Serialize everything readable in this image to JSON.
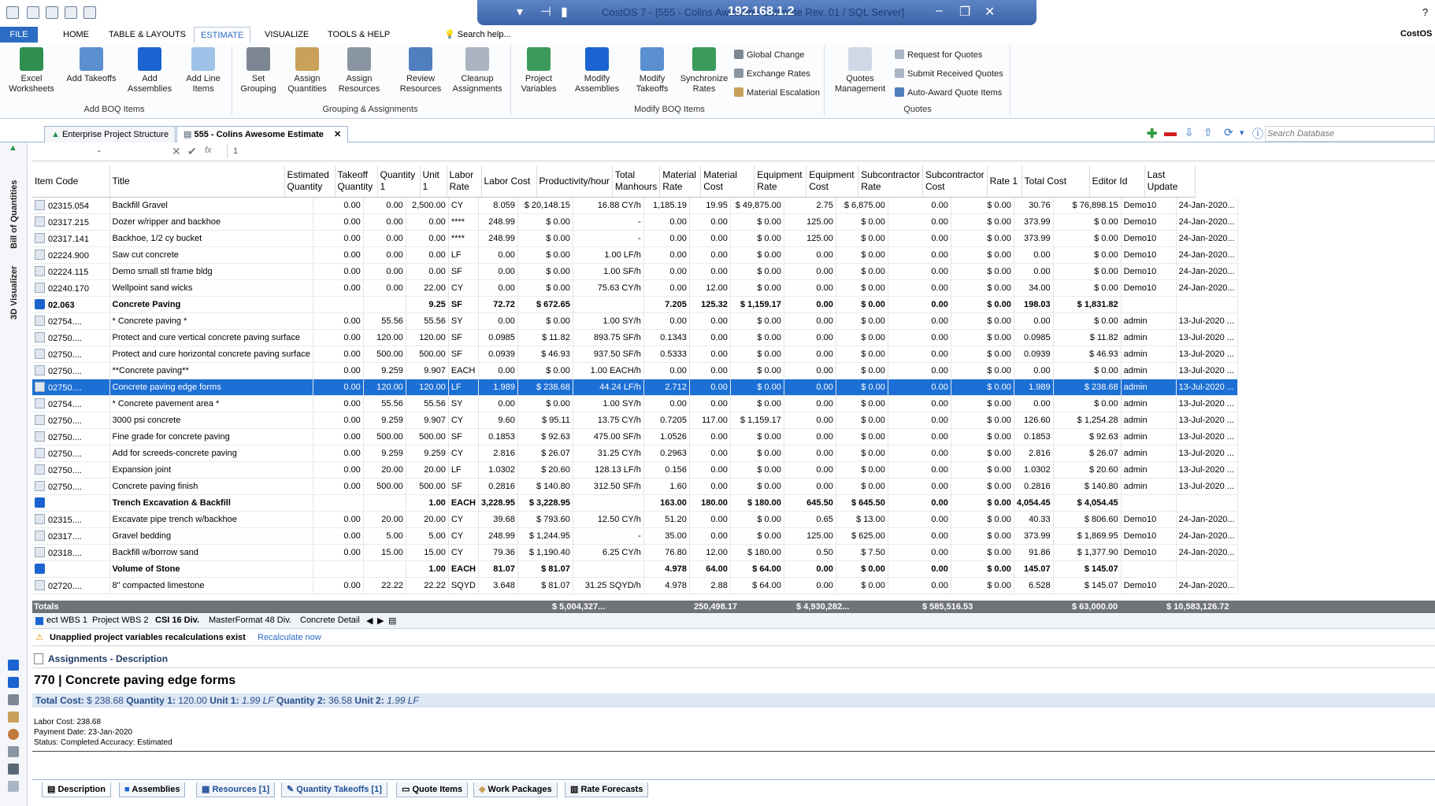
{
  "window": {
    "ip": "192.168.1.2",
    "title": "CostOS 7 - [555 - Colins Awesome Estimate  Rev. 01 / SQL Server]",
    "app_label": "CostOS",
    "help_char": "?"
  },
  "ribbon": {
    "tabs": [
      "FILE",
      "HOME",
      "TABLE & LAYOUTS",
      "ESTIMATE",
      "VISUALIZE",
      "TOOLS & HELP"
    ],
    "active_tab": "ESTIMATE",
    "search_help": "Search help...",
    "buttons": {
      "excel": "Excel Worksheets",
      "add_takeoffs": "Add Takeoffs",
      "add_assemblies": "Add Assemblies",
      "add_line_items": "Add Line Items",
      "set_grouping": "Set Grouping",
      "assign_quantities": "Assign Quantities",
      "assign_resources": "Assign Resources",
      "review_resources": "Review Resources",
      "cleanup_assignments": "Cleanup Assignments",
      "project_variables": "Project Variables",
      "modify_assemblies": "Modify Assemblies",
      "modify_takeoffs": "Modify Takeoffs",
      "synchronize_rates": "Synchronize Rates",
      "global_change": "Global Change",
      "exchange_rates": "Exchange Rates",
      "material_escalation": "Material Escalation",
      "quotes_management": "Quotes Management",
      "request_for_quotes": "Request for Quotes",
      "submit_received_quotes": "Submit Received Quotes",
      "auto_award": "Auto-Award Quote Items"
    },
    "groups": [
      "Add BOQ Items",
      "Grouping & Assignments",
      "Modify BOQ Items",
      "Quotes"
    ]
  },
  "doc_tabs": [
    "Enterprise Project Structure",
    "555 - Colins Awesome Estimate"
  ],
  "search_database_placeholder": "Search Database",
  "formula_bar": {
    "cell_ref": "-",
    "value": "1"
  },
  "left_strip": {
    "bill_of_quantities": "Bill of Quantities",
    "visualizer": "3D Visualizer"
  },
  "columns": [
    "Item Code",
    "Title",
    "Estimated Quantity",
    "Takeoff Quantity",
    "Quantity 1",
    "Unit 1",
    "Labor Rate",
    "Labor Cost",
    "Productivity/hour",
    "Total Manhours",
    "Material Rate",
    "Material Cost",
    "Equipment Rate",
    "Equipment Cost",
    "Subcontractor Rate",
    "Subcontractor Cost",
    "Rate 1",
    "Total Cost",
    "Editor Id",
    "Last Update"
  ],
  "rows": [
    {
      "lvl": 2,
      "code": "02315.054",
      "title": "Backfill Gravel",
      "eq": "0.00",
      "tq": "0.00",
      "q1": "2,500.00",
      "u": "CY",
      "lr": "8.059",
      "lc": "$ 20,148.15",
      "prod": "16.88 CY/h",
      "mh": "1,185.19",
      "mr": "19.95",
      "mc": "$ 49,875.00",
      "er": "2.75",
      "ec": "$ 6,875.00",
      "sr": "0.00",
      "sc": "$ 0.00",
      "r1": "30.76",
      "tc": "$ 76,898.15",
      "ed": "Demo10",
      "lu": "24-Jan-2020..."
    },
    {
      "lvl": 2,
      "code": "02317.215",
      "title": "Dozer w/ripper and backhoe",
      "eq": "0.00",
      "tq": "0.00",
      "q1": "0.00",
      "u": "****",
      "lr": "248.99",
      "lc": "$ 0.00",
      "prod": "-",
      "mh": "0.00",
      "mr": "0.00",
      "mc": "$ 0.00",
      "er": "125.00",
      "ec": "$ 0.00",
      "sr": "0.00",
      "sc": "$ 0.00",
      "r1": "373.99",
      "tc": "$ 0.00",
      "ed": "Demo10",
      "lu": "24-Jan-2020..."
    },
    {
      "lvl": 2,
      "code": "02317.141",
      "title": "Backhoe, 1/2 cy bucket",
      "eq": "0.00",
      "tq": "0.00",
      "q1": "0.00",
      "u": "****",
      "lr": "248.99",
      "lc": "$ 0.00",
      "prod": "-",
      "mh": "0.00",
      "mr": "0.00",
      "mc": "$ 0.00",
      "er": "125.00",
      "ec": "$ 0.00",
      "sr": "0.00",
      "sc": "$ 0.00",
      "r1": "373.99",
      "tc": "$ 0.00",
      "ed": "Demo10",
      "lu": "24-Jan-2020..."
    },
    {
      "lvl": 2,
      "code": "02224.900",
      "title": "Saw cut concrete",
      "eq": "0.00",
      "tq": "0.00",
      "q1": "0.00",
      "u": "LF",
      "lr": "0.00",
      "lc": "$ 0.00",
      "prod": "1.00 LF/h",
      "mh": "0.00",
      "mr": "0.00",
      "mc": "$ 0.00",
      "er": "0.00",
      "ec": "$ 0.00",
      "sr": "0.00",
      "sc": "$ 0.00",
      "r1": "0.00",
      "tc": "$ 0.00",
      "ed": "Demo10",
      "lu": "24-Jan-2020..."
    },
    {
      "lvl": 2,
      "code": "02224.115",
      "title": "Demo small stl frame bldg",
      "eq": "0.00",
      "tq": "0.00",
      "q1": "0.00",
      "u": "SF",
      "lr": "0.00",
      "lc": "$ 0.00",
      "prod": "1.00 SF/h",
      "mh": "0.00",
      "mr": "0.00",
      "mc": "$ 0.00",
      "er": "0.00",
      "ec": "$ 0.00",
      "sr": "0.00",
      "sc": "$ 0.00",
      "r1": "0.00",
      "tc": "$ 0.00",
      "ed": "Demo10",
      "lu": "24-Jan-2020..."
    },
    {
      "lvl": 2,
      "code": "02240.170",
      "title": "Wellpoint sand wicks",
      "eq": "0.00",
      "tq": "0.00",
      "q1": "22.00",
      "u": "CY",
      "lr": "0.00",
      "lc": "$ 0.00",
      "prod": "75.63 CY/h",
      "mh": "0.00",
      "mr": "12.00",
      "mc": "$ 0.00",
      "er": "0.00",
      "ec": "$ 0.00",
      "sr": "0.00",
      "sc": "$ 0.00",
      "r1": "34.00",
      "tc": "$ 0.00",
      "ed": "Demo10",
      "lu": "24-Jan-2020..."
    },
    {
      "lvl": 1,
      "bold": true,
      "code": "02.063",
      "title": "Concrete Paving",
      "eq": "",
      "tq": "",
      "q1": "9.25",
      "u": "SF",
      "lr": "72.72",
      "lc": "$ 672.65",
      "prod": "",
      "mh": "7.205",
      "mr": "125.32",
      "mc": "$ 1,159.17",
      "er": "0.00",
      "ec": "$ 0.00",
      "sr": "0.00",
      "sc": "$ 0.00",
      "r1": "198.03",
      "tc": "$ 1,831.82",
      "ed": "",
      "lu": ""
    },
    {
      "lvl": 3,
      "code": "02754....",
      "title": "* Concrete paving *",
      "eq": "0.00",
      "tq": "55.56",
      "q1": "55.56",
      "u": "SY",
      "lr": "0.00",
      "lc": "$ 0.00",
      "prod": "1.00 SY/h",
      "mh": "0.00",
      "mr": "0.00",
      "mc": "$ 0.00",
      "er": "0.00",
      "ec": "$ 0.00",
      "sr": "0.00",
      "sc": "$ 0.00",
      "r1": "0.00",
      "tc": "$ 0.00",
      "ed": "admin",
      "lu": "13-Jul-2020 ..."
    },
    {
      "lvl": 3,
      "code": "02750....",
      "title": "Protect and cure vertical concrete paving surface",
      "eq": "0.00",
      "tq": "120.00",
      "q1": "120.00",
      "u": "SF",
      "lr": "0.0985",
      "lc": "$ 11.82",
      "prod": "893.75 SF/h",
      "mh": "0.1343",
      "mr": "0.00",
      "mc": "$ 0.00",
      "er": "0.00",
      "ec": "$ 0.00",
      "sr": "0.00",
      "sc": "$ 0.00",
      "r1": "0.0985",
      "tc": "$ 11.82",
      "ed": "admin",
      "lu": "13-Jul-2020 ..."
    },
    {
      "lvl": 3,
      "code": "02750....",
      "title": "Protect and cure horizontal concrete paving surface",
      "eq": "0.00",
      "tq": "500.00",
      "q1": "500.00",
      "u": "SF",
      "lr": "0.0939",
      "lc": "$ 46.93",
      "prod": "937.50 SF/h",
      "mh": "0.5333",
      "mr": "0.00",
      "mc": "$ 0.00",
      "er": "0.00",
      "ec": "$ 0.00",
      "sr": "0.00",
      "sc": "$ 0.00",
      "r1": "0.0939",
      "tc": "$ 46.93",
      "ed": "admin",
      "lu": "13-Jul-2020 ..."
    },
    {
      "lvl": 3,
      "code": "02750....",
      "title": "**Concrete paving**",
      "eq": "0.00",
      "tq": "9.259",
      "q1": "9.907",
      "u": "EACH",
      "lr": "0.00",
      "lc": "$ 0.00",
      "prod": "1.00 EACH/h",
      "mh": "0.00",
      "mr": "0.00",
      "mc": "$ 0.00",
      "er": "0.00",
      "ec": "$ 0.00",
      "sr": "0.00",
      "sc": "$ 0.00",
      "r1": "0.00",
      "tc": "$ 0.00",
      "ed": "admin",
      "lu": "13-Jul-2020 ..."
    },
    {
      "lvl": 3,
      "sel": true,
      "code": "02750....",
      "title": "Concrete paving edge forms",
      "eq": "0.00",
      "tq": "120.00",
      "q1": "120.00",
      "u": "LF",
      "lr": "1.989",
      "lc": "$ 238.68",
      "prod": "44.24 LF/h",
      "mh": "2.712",
      "mr": "0.00",
      "mc": "$ 0.00",
      "er": "0.00",
      "ec": "$ 0.00",
      "sr": "0.00",
      "sc": "$ 0.00",
      "r1": "1.989",
      "tc": "$ 238.68",
      "ed": "admin",
      "lu": "13-Jul-2020 ..."
    },
    {
      "lvl": 3,
      "code": "02754....",
      "title": "* Concrete pavement area *",
      "eq": "0.00",
      "tq": "55.56",
      "q1": "55.56",
      "u": "SY",
      "lr": "0.00",
      "lc": "$ 0.00",
      "prod": "1.00 SY/h",
      "mh": "0.00",
      "mr": "0.00",
      "mc": "$ 0.00",
      "er": "0.00",
      "ec": "$ 0.00",
      "sr": "0.00",
      "sc": "$ 0.00",
      "r1": "0.00",
      "tc": "$ 0.00",
      "ed": "admin",
      "lu": "13-Jul-2020 ..."
    },
    {
      "lvl": 3,
      "code": "02750....",
      "title": "3000 psi concrete",
      "eq": "0.00",
      "tq": "9.259",
      "q1": "9.907",
      "u": "CY",
      "lr": "9.60",
      "lc": "$ 95.11",
      "prod": "13.75 CY/h",
      "mh": "0.7205",
      "mr": "117.00",
      "mc": "$ 1,159.17",
      "er": "0.00",
      "ec": "$ 0.00",
      "sr": "0.00",
      "sc": "$ 0.00",
      "r1": "126.60",
      "tc": "$ 1,254.28",
      "ed": "admin",
      "lu": "13-Jul-2020 ..."
    },
    {
      "lvl": 3,
      "code": "02750....",
      "title": "Fine grade for concrete paving",
      "eq": "0.00",
      "tq": "500.00",
      "q1": "500.00",
      "u": "SF",
      "lr": "0.1853",
      "lc": "$ 92.63",
      "prod": "475.00 SF/h",
      "mh": "1.0526",
      "mr": "0.00",
      "mc": "$ 0.00",
      "er": "0.00",
      "ec": "$ 0.00",
      "sr": "0.00",
      "sc": "$ 0.00",
      "r1": "0.1853",
      "tc": "$ 92.63",
      "ed": "admin",
      "lu": "13-Jul-2020 ..."
    },
    {
      "lvl": 3,
      "code": "02750....",
      "title": "Add for screeds-concrete paving",
      "eq": "0.00",
      "tq": "9.259",
      "q1": "9.259",
      "u": "CY",
      "lr": "2.816",
      "lc": "$ 26.07",
      "prod": "31.25 CY/h",
      "mh": "0.2963",
      "mr": "0.00",
      "mc": "$ 0.00",
      "er": "0.00",
      "ec": "$ 0.00",
      "sr": "0.00",
      "sc": "$ 0.00",
      "r1": "2.816",
      "tc": "$ 26.07",
      "ed": "admin",
      "lu": "13-Jul-2020 ..."
    },
    {
      "lvl": 3,
      "code": "02750....",
      "title": "Expansion joint",
      "eq": "0.00",
      "tq": "20.00",
      "q1": "20.00",
      "u": "LF",
      "lr": "1.0302",
      "lc": "$ 20.60",
      "prod": "128.13 LF/h",
      "mh": "0.156",
      "mr": "0.00",
      "mc": "$ 0.00",
      "er": "0.00",
      "ec": "$ 0.00",
      "sr": "0.00",
      "sc": "$ 0.00",
      "r1": "1.0302",
      "tc": "$ 20.60",
      "ed": "admin",
      "lu": "13-Jul-2020 ..."
    },
    {
      "lvl": 3,
      "code": "02750....",
      "title": "Concrete paving finish",
      "eq": "0.00",
      "tq": "500.00",
      "q1": "500.00",
      "u": "SF",
      "lr": "0.2816",
      "lc": "$ 140.80",
      "prod": "312.50 SF/h",
      "mh": "1.60",
      "mr": "0.00",
      "mc": "$ 0.00",
      "er": "0.00",
      "ec": "$ 0.00",
      "sr": "0.00",
      "sc": "$ 0.00",
      "r1": "0.2816",
      "tc": "$ 140.80",
      "ed": "admin",
      "lu": "13-Jul-2020 ..."
    },
    {
      "lvl": 1,
      "bold": true,
      "code": "",
      "title": "Trench Excavation & Backfill",
      "eq": "",
      "tq": "",
      "q1": "1.00",
      "u": "EACH",
      "lr": "3,228.95",
      "lc": "$ 3,228.95",
      "prod": "",
      "mh": "163.00",
      "mr": "180.00",
      "mc": "$ 180.00",
      "er": "645.50",
      "ec": "$ 645.50",
      "sr": "0.00",
      "sc": "$ 0.00",
      "r1": "4,054.45",
      "tc": "$ 4,054.45",
      "ed": "",
      "lu": ""
    },
    {
      "lvl": 3,
      "code": "02315....",
      "title": "Excavate pipe trench w/backhoe",
      "eq": "0.00",
      "tq": "20.00",
      "q1": "20.00",
      "u": "CY",
      "lr": "39.68",
      "lc": "$ 793.60",
      "prod": "12.50 CY/h",
      "mh": "51.20",
      "mr": "0.00",
      "mc": "$ 0.00",
      "er": "0.65",
      "ec": "$ 13.00",
      "sr": "0.00",
      "sc": "$ 0.00",
      "r1": "40.33",
      "tc": "$ 806.60",
      "ed": "Demo10",
      "lu": "24-Jan-2020..."
    },
    {
      "lvl": 3,
      "code": "02317....",
      "title": "Gravel bedding",
      "eq": "0.00",
      "tq": "5.00",
      "q1": "5.00",
      "u": "CY",
      "lr": "248.99",
      "lc": "$ 1,244.95",
      "prod": "-",
      "mh": "35.00",
      "mr": "0.00",
      "mc": "$ 0.00",
      "er": "125.00",
      "ec": "$ 625.00",
      "sr": "0.00",
      "sc": "$ 0.00",
      "r1": "373.99",
      "tc": "$ 1,869.95",
      "ed": "Demo10",
      "lu": "24-Jan-2020..."
    },
    {
      "lvl": 3,
      "code": "02318....",
      "title": "Backfill w/borrow sand",
      "eq": "0.00",
      "tq": "15.00",
      "q1": "15.00",
      "u": "CY",
      "lr": "79.36",
      "lc": "$ 1,190.40",
      "prod": "6.25 CY/h",
      "mh": "76.80",
      "mr": "12.00",
      "mc": "$ 180.00",
      "er": "0.50",
      "ec": "$ 7.50",
      "sr": "0.00",
      "sc": "$ 0.00",
      "r1": "91.86",
      "tc": "$ 1,377.90",
      "ed": "Demo10",
      "lu": "24-Jan-2020..."
    },
    {
      "lvl": 1,
      "bold": true,
      "code": "",
      "title": "Volume of Stone",
      "eq": "",
      "tq": "",
      "q1": "1.00",
      "u": "EACH",
      "lr": "81.07",
      "lc": "$ 81.07",
      "prod": "",
      "mh": "4.978",
      "mr": "64.00",
      "mc": "$ 64.00",
      "er": "0.00",
      "ec": "$ 0.00",
      "sr": "0.00",
      "sc": "$ 0.00",
      "r1": "145.07",
      "tc": "$ 145.07",
      "ed": "",
      "lu": ""
    },
    {
      "lvl": 3,
      "code": "02720....",
      "title": "8\" compacted limestone",
      "eq": "0.00",
      "tq": "22.22",
      "q1": "22.22",
      "u": "SQYD",
      "lr": "3.648",
      "lc": "$ 81.07",
      "prod": "31.25 SQYD/h",
      "mh": "4.978",
      "mr": "2.88",
      "mc": "$ 64.00",
      "er": "0.00",
      "ec": "$ 0.00",
      "sr": "0.00",
      "sc": "$ 0.00",
      "r1": "6.528",
      "tc": "$ 145.07",
      "ed": "Demo10",
      "lu": "24-Jan-2020..."
    }
  ],
  "totals": {
    "label": "Totals",
    "labor_cost": "$ 5,004,327...",
    "manhours": "250,498.17",
    "material_cost": "$ 4,930,282...",
    "equipment_cost": "$ 585,516.53",
    "subcontractor_cost": "$ 63,000.00",
    "total_cost": "$ 10,583,126.72"
  },
  "sheet_tabs": [
    "ect WBS 1",
    "Project WBS 2",
    "CSI 16 Div.",
    "MasterFormat 48 Div.",
    "Concrete Detail"
  ],
  "warning": {
    "text": "Unapplied project variables recalculations exist",
    "link": "Recalculate now"
  },
  "details": {
    "header": "Assignments - Description",
    "title": "770 | Concrete paving edge forms",
    "summary_label_total": "Total Cost:",
    "summary_total": "$ 238.68",
    "summary_label_q1": "Quantity 1:",
    "summary_q1": "120.00",
    "summary_label_u1": "Unit 1:",
    "summary_u1": "1.99 LF",
    "summary_label_q2": "Quantity 2:",
    "summary_q2": "36.58",
    "summary_label_u2": "Unit 2:",
    "summary_u2": "1.99 LF",
    "labor_cost": "Labor Cost: 238.68",
    "payment_date": "Payment Date: 23-Jan-2020",
    "status": "Status: Completed Accuracy: Estimated"
  },
  "bottom_tabs": [
    "Description",
    "Assemblies",
    "Resources [1]",
    "Quantity Takeoffs [1]",
    "Quote Items",
    "Work Packages",
    "Rate Forecasts"
  ],
  "colors": {
    "accent": "#2b6cc4",
    "selection": "#1c6fd4",
    "totals_bar": "#707377"
  }
}
